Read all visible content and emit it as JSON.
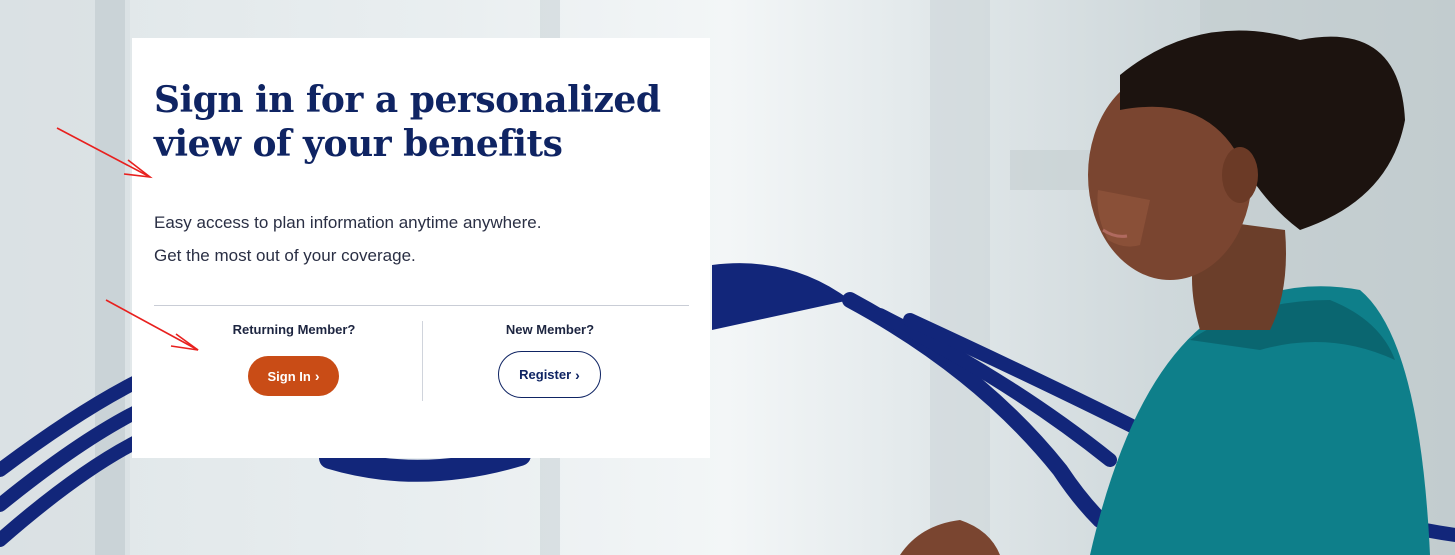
{
  "hero": {
    "title": "Sign in for a personalized view of your benefits",
    "subtitle_line1": "Easy access to plan information anytime anywhere.",
    "subtitle_line2": "Get the most out of your coverage."
  },
  "returning": {
    "label": "Returning Member?",
    "button": "Sign In",
    "chevron": "›"
  },
  "new_member": {
    "label": "New Member?",
    "button": "Register",
    "chevron": "›"
  },
  "colors": {
    "navy": "#0f2463",
    "orange": "#c94c16",
    "teal": "#0e7f8a",
    "annotation_red": "#e8201e"
  }
}
